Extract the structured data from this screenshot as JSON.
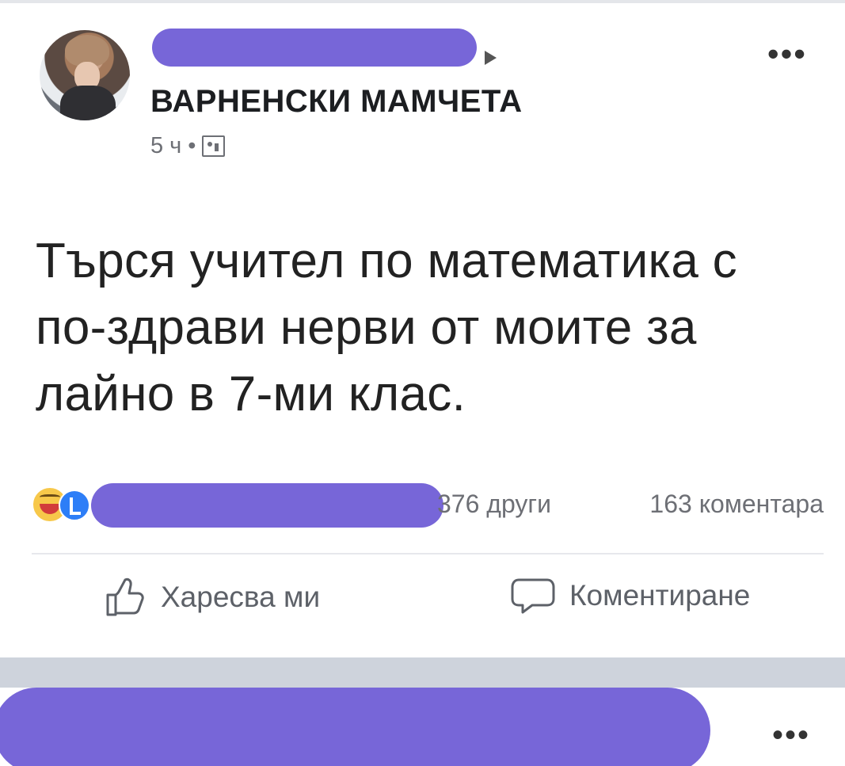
{
  "post": {
    "group_name": "ВАРНЕНСКИ МАМЧЕТА",
    "time": "5 ч",
    "separator": "•",
    "text": "Търся учител по математика с по-здрави нерви от моите за лайно в 7-ми клас.",
    "more_label": "•••"
  },
  "reactions": {
    "others_text": "376 други",
    "comments_text": "163 коментара"
  },
  "actions": {
    "like_label": "Харесва ми",
    "comment_label": "Коментиране"
  },
  "next_post": {
    "more_label": "•••"
  },
  "colors": {
    "redaction": "#7766d8",
    "text": "#222222",
    "muted": "#6d6f75",
    "separator": "#ced3dc"
  }
}
